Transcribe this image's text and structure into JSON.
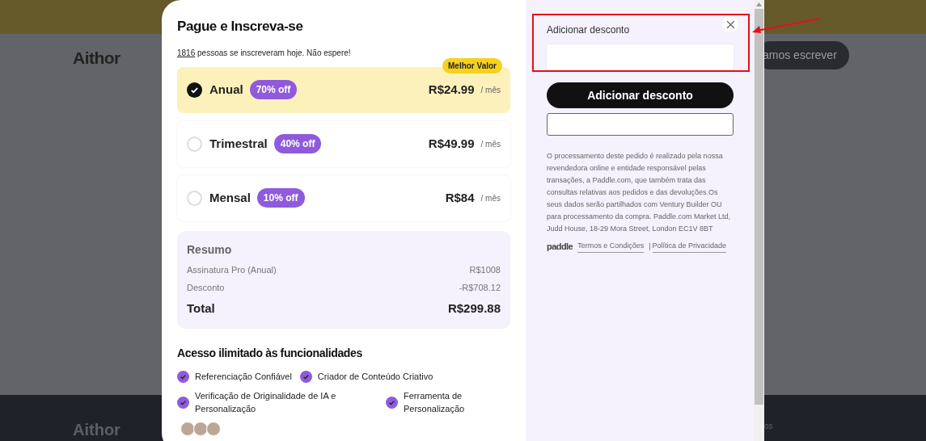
{
  "page": {
    "logo": "Aithor",
    "cta": "amos escrever",
    "footer_logo": "Aithor",
    "footer_fragment": "os"
  },
  "checkout": {
    "title": "Pague e Inscreva-se",
    "count": "1816",
    "subtitle": "pessoas se inscreveram hoje. Não espere!",
    "plans": [
      {
        "name": "Anual",
        "discount": "70% off",
        "price": "R$24.99",
        "period": "/ mês",
        "badge": "Melhor Valor",
        "selected": true
      },
      {
        "name": "Trimestral",
        "discount": "40% off",
        "price": "R$49.99",
        "period": "/ mês",
        "selected": false
      },
      {
        "name": "Mensal",
        "discount": "10% off",
        "price": "R$84",
        "period": "/ mês",
        "selected": false
      }
    ],
    "summary": {
      "title": "Resumo",
      "rows": [
        {
          "label": "Assinatura Pro (Anual)",
          "value": "R$1008"
        },
        {
          "label": "Desconto",
          "value": "-R$708.12"
        }
      ],
      "total_label": "Total",
      "total_value": "R$299.88"
    },
    "features_title": "Acesso ilimitado às funcionalidades",
    "features": [
      "Referenciação Confiável",
      "Criador de Conteúdo Criativo",
      "Verificação de Originalidade de IA e Personalização",
      "Ferramenta de Personalização"
    ]
  },
  "discount": {
    "label": "Adicionar desconto",
    "button": "Adicionar desconto",
    "legal": "O processamento deste pedido é realizado pela nossa revendedora online e entidade responsável pelas transações, a Paddle.com, que também trata das consultas relativas aos pedidos e das devoluções.Os seus dados serão partilhados com Ventury Builder OU para processamento da compra. Paddle.com Market Ltd, Judd House, 18-29 Mora Street, London EC1V 8BT",
    "brand": "paddle",
    "links": [
      "Termos e Condições",
      "Política de Privacidade"
    ],
    "separator": "|"
  }
}
